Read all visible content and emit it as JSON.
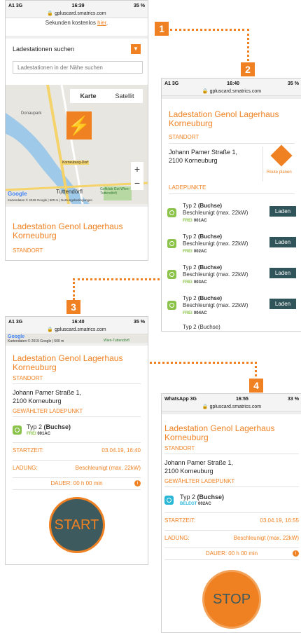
{
  "badges": [
    "1",
    "2",
    "3",
    "4"
  ],
  "phone1": {
    "status_left": "A1  3G",
    "time": "16:39",
    "status_right": "35 %",
    "url": "gpluscard.smatrics.com",
    "top_text": "Sekunden kostenlos",
    "top_link": "hier",
    "search_label": "Ladestationen suchen",
    "search_placeholder": "Ladestationen in der Nähe suchen",
    "map_tab_karte": "Karte",
    "map_tab_satellit": "Satellit",
    "map_labels": {
      "donaupark": "Donaupark",
      "korneuburg": "Korneuburg-Dorf",
      "tuttendorf": "Tuttendörfl",
      "golfclub": "Golfclub Gut Wien-Tuttendörfl",
      "google": "Google",
      "footer": "Kartendaten © 2019 Google | 500 m | Nutzungsbedingungen"
    },
    "zoom_in": "+",
    "zoom_out": "−",
    "station_title": "Ladestation Genol Lagerhaus Korneuburg",
    "standort": "STANDORT"
  },
  "phone2": {
    "status_left": "A1  3G",
    "time": "16:40",
    "status_right": "35 %",
    "url": "gpluscard.smatrics.com",
    "station_title": "Ladestation Genol Lagerhaus Korneuburg",
    "standort": "STANDORT",
    "address1": "Johann Pamer Straße 1,",
    "address2": "2100 Korneuburg",
    "route": "Route planen",
    "ladepunkte": "LADEPUNKTE",
    "points": [
      {
        "type": "Typ 2",
        "kind": "(Buchse)",
        "speed": "Beschleunigt (max. 22kW)",
        "status": "FREI",
        "id": "001AC",
        "btn": "Laden"
      },
      {
        "type": "Typ 2",
        "kind": "(Buchse)",
        "speed": "Beschleunigt (max. 22kW)",
        "status": "FREI",
        "id": "002AC",
        "btn": "Laden"
      },
      {
        "type": "Typ 2",
        "kind": "(Buchse)",
        "speed": "Beschleunigt (max. 22kW)",
        "status": "FREI",
        "id": "003AC",
        "btn": "Laden"
      },
      {
        "type": "Typ 2",
        "kind": "(Buchse)",
        "speed": "Beschleunigt (max. 22kW)",
        "status": "FREI",
        "id": "004AC",
        "btn": "Laden"
      }
    ],
    "last_point": "Typ 2 (Buchse)"
  },
  "phone3": {
    "status_left": "A1  3G",
    "time": "16:40",
    "status_right": "35 %",
    "url": "gpluscard.smatrics.com",
    "map_footer": "Kartendaten © 2019 Google | 500 m",
    "map_golf": "Wien-Tuttendörfl",
    "station_title": "Ladestation Genol Lagerhaus Korneuburg",
    "standort": "STANDORT",
    "address1": "Johann Pamer Straße 1,",
    "address2": "2100 Korneuburg",
    "gewaehlt": "GEWÄHLTER LADEPUNKT",
    "point_type": "Typ 2",
    "point_kind": "(Buchse)",
    "point_status": "FREI",
    "point_id": "001AC",
    "startzeit_label": "STARTZEIT:",
    "startzeit_value": "03.04.19, 16:40",
    "ladung_label": "LADUNG:",
    "ladung_value": "Beschleunigt (max. 22kW)",
    "dauer": "DAUER: 00 h 00 min",
    "start_btn": "START"
  },
  "phone4": {
    "status_left": "WhatsApp  3G",
    "time": "16:55",
    "status_right": "33 %",
    "url": "gpluscard.smatrics.com",
    "station_title": "Ladestation Genol Lagerhaus Korneuburg",
    "standort": "STANDORT",
    "address1": "Johann Pamer Straße 1,",
    "address2": "2100 Korneuburg",
    "gewaehlt": "GEWÄHLTER LADEPUNKT",
    "point_type": "Typ 2",
    "point_kind": "(Buchse)",
    "point_status": "BELEGT",
    "point_id": "002AC",
    "startzeit_label": "STARTZEIT:",
    "startzeit_value": "03.04.19, 16:55",
    "ladung_label": "LADUNG:",
    "ladung_value": "Beschleunigt (max. 22kW)",
    "dauer": "DAUER: 00 h 00 min",
    "stop_btn": "STOP"
  },
  "colors": {
    "accent": "#f08122",
    "dark_button": "#2f5459",
    "free": "#8bc34a",
    "busy": "#29b6d6",
    "start_circle": "#3d5a5e"
  }
}
